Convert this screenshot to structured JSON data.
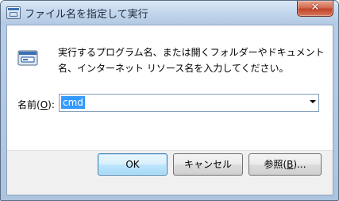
{
  "window": {
    "title": "ファイル名を指定して実行",
    "close_glyph": "✕"
  },
  "dialog": {
    "message": "実行するプログラム名、または開くフォルダーやドキュメント名、インターネット リソース名を入力してください。",
    "open_label_before": "名前(",
    "open_label_access": "O",
    "open_label_after": "):",
    "open_value": "cmd"
  },
  "buttons": {
    "ok": "OK",
    "cancel": "キャンセル",
    "browse_before": "参照(",
    "browse_access": "B",
    "browse_after": ")..."
  },
  "icons": {
    "title": "run-dialog-icon",
    "run": "run-program-icon",
    "close": "close-icon",
    "dropdown": "chevron-down-icon"
  },
  "colors": {
    "selection": "#3399ff",
    "close_button": "#c2442a",
    "default_button_border": "#3c7fb1"
  }
}
